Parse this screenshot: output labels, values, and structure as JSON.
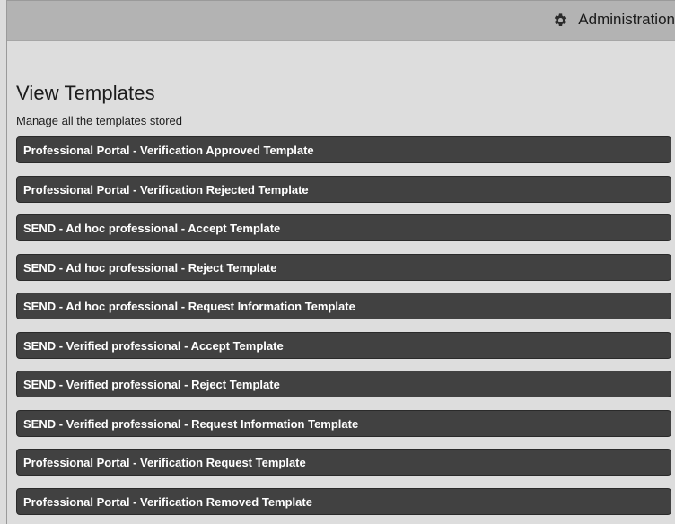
{
  "header": {
    "admin_label": "Administration",
    "admin_icon": "gear-icon"
  },
  "page": {
    "title": "View Templates",
    "subtitle": "Manage all the templates stored"
  },
  "templates": [
    {
      "label": "Professional Portal - Verification Approved Template"
    },
    {
      "label": "Professional Portal - Verification Rejected Template"
    },
    {
      "label": "SEND - Ad hoc professional - Accept Template"
    },
    {
      "label": "SEND - Ad hoc professional - Reject Template"
    },
    {
      "label": "SEND - Ad hoc professional - Request Information Template"
    },
    {
      "label": "SEND - Verified professional - Accept Template"
    },
    {
      "label": "SEND - Verified professional - Reject Template"
    },
    {
      "label": "SEND - Verified professional - Request Information Template"
    },
    {
      "label": "Professional Portal - Verification Request Template"
    },
    {
      "label": "Professional Portal - Verification Removed Template"
    }
  ],
  "colors": {
    "topbar": "#b3b3b3",
    "background": "#dddddd",
    "item_background": "#414141",
    "item_text": "#ffffff"
  }
}
